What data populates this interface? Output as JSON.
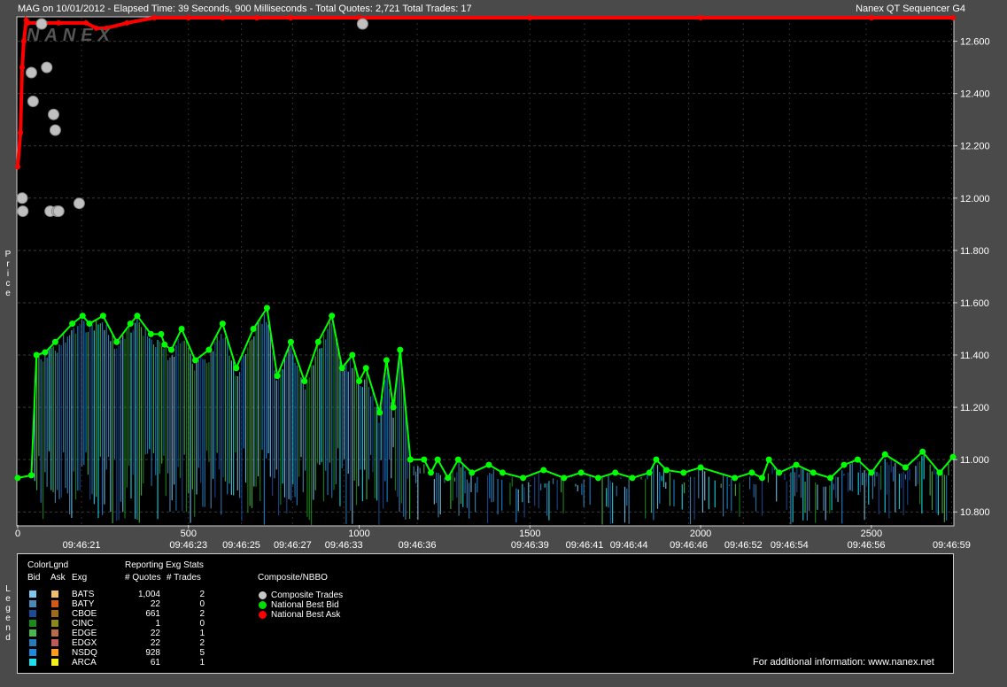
{
  "header": {
    "left": "MAG on 10/01/2012  -  Elapsed Time: 39 Seconds, 900 Milliseconds  -  Total Quotes: 2,721  Total Trades: 17",
    "right": "Nanex QT Sequencer G4",
    "watermark": "NANEX"
  },
  "side_labels": {
    "price": "Price",
    "legend": "Legend"
  },
  "chart_data": {
    "type": "line",
    "ylabel": "Price",
    "ylim": [
      10.75,
      12.69
    ],
    "xlim": [
      0,
      2739
    ],
    "y_ticks": [
      "12.600",
      "12.400",
      "12.200",
      "12.000",
      "11.800",
      "11.600",
      "11.400",
      "11.200",
      "11.000",
      "10.800"
    ],
    "y_tick_values": [
      12.6,
      12.4,
      12.2,
      12.0,
      11.8,
      11.6,
      11.4,
      11.2,
      11.0,
      10.8
    ],
    "x_ticks_top": [
      "0",
      "500",
      "1000",
      "1500",
      "2000",
      "2500"
    ],
    "x_tick_top_values": [
      0,
      500,
      1000,
      1500,
      2000,
      2500
    ],
    "x_ticks_time": [
      "09:46:21",
      "09:46:23",
      "09:46:25",
      "09:46:27",
      "09:46:33",
      "09:46:36",
      "09:46:39",
      "09:46:41",
      "09:46:44",
      "09:46:46",
      "09:46:52",
      "09:46:54",
      "09:46:56",
      "09:46:59"
    ],
    "x_tick_time_positions": [
      187,
      500,
      655,
      805,
      955,
      1170,
      1500,
      1660,
      1790,
      1965,
      2125,
      2260,
      2485,
      2735
    ],
    "series": [
      {
        "name": "National Best Ask",
        "color": "#ff0000",
        "x": [
          0,
          8,
          13,
          18,
          25,
          30,
          60,
          120,
          200,
          230,
          260,
          320,
          400,
          500,
          600,
          700,
          800,
          1000,
          1500,
          2000,
          2500,
          2739
        ],
        "y": [
          12.12,
          12.25,
          12.5,
          12.6,
          12.68,
          12.67,
          12.67,
          12.67,
          12.67,
          12.65,
          12.65,
          12.67,
          12.69,
          12.69,
          12.69,
          12.69,
          12.69,
          12.69,
          12.69,
          12.69,
          12.69,
          12.69
        ]
      },
      {
        "name": "National Best Bid",
        "color": "#00ff00",
        "x": [
          0,
          40,
          55,
          80,
          110,
          160,
          190,
          210,
          250,
          290,
          330,
          350,
          390,
          420,
          430,
          450,
          480,
          520,
          560,
          600,
          640,
          690,
          730,
          760,
          800,
          840,
          880,
          920,
          950,
          980,
          1000,
          1020,
          1060,
          1080,
          1100,
          1120,
          1150,
          1190,
          1210,
          1230,
          1260,
          1290,
          1330,
          1380,
          1420,
          1480,
          1540,
          1600,
          1650,
          1700,
          1750,
          1800,
          1850,
          1870,
          1900,
          1950,
          2000,
          2100,
          2150,
          2180,
          2200,
          2230,
          2280,
          2330,
          2380,
          2420,
          2460,
          2500,
          2540,
          2600,
          2650,
          2700,
          2739
        ],
        "y": [
          10.93,
          10.94,
          11.4,
          11.41,
          11.45,
          11.52,
          11.55,
          11.52,
          11.55,
          11.45,
          11.52,
          11.55,
          11.48,
          11.48,
          11.44,
          11.42,
          11.5,
          11.38,
          11.42,
          11.52,
          11.35,
          11.5,
          11.58,
          11.32,
          11.45,
          11.3,
          11.45,
          11.55,
          11.35,
          11.4,
          11.3,
          11.35,
          11.18,
          11.38,
          11.2,
          11.42,
          11.0,
          11.0,
          10.95,
          11.0,
          10.93,
          11.0,
          10.95,
          10.98,
          10.95,
          10.93,
          10.96,
          10.93,
          10.95,
          10.93,
          10.95,
          10.93,
          10.95,
          11.0,
          10.96,
          10.95,
          10.97,
          10.93,
          10.95,
          10.93,
          11.0,
          10.95,
          10.98,
          10.95,
          10.93,
          10.98,
          11.0,
          10.95,
          11.02,
          10.97,
          11.03,
          10.95,
          11.01
        ]
      },
      {
        "name": "Composite Trades",
        "color": "#c0c0c0",
        "x": [
          13,
          15,
          40,
          45,
          70,
          85,
          95,
          105,
          110,
          115,
          120,
          180,
          1010
        ],
        "y": [
          12.0,
          11.95,
          12.48,
          12.37,
          12.71,
          12.5,
          11.95,
          12.32,
          12.26,
          11.95,
          11.95,
          11.98,
          12.69
        ]
      }
    ]
  },
  "legend": {
    "color_legend_title": "ColorLgnd",
    "stats_title": "Reporting Exg Stats",
    "composite_title": "Composite/NBBO",
    "headers": {
      "bid": "Bid",
      "ask": "Ask",
      "exg": "Exg",
      "quotes": "# Quotes",
      "trades": "# Trades"
    },
    "rows": [
      {
        "exg": "BATS",
        "quotes": "1,004",
        "trades": "2",
        "bid_color": "#7ec8f0",
        "ask_color": "#f0c070"
      },
      {
        "exg": "BATY",
        "quotes": "22",
        "trades": "0",
        "bid_color": "#4a8ab8",
        "ask_color": "#d05a1a"
      },
      {
        "exg": "CBOE",
        "quotes": "661",
        "trades": "2",
        "bid_color": "#1a4a9a",
        "ask_color": "#a06a1a"
      },
      {
        "exg": "CINC",
        "quotes": "1",
        "trades": "0",
        "bid_color": "#1a8a1a",
        "ask_color": "#8a8a1a"
      },
      {
        "exg": "EDGE",
        "quotes": "22",
        "trades": "1",
        "bid_color": "#4ab84a",
        "ask_color": "#b86a4a"
      },
      {
        "exg": "EDGX",
        "quotes": "22",
        "trades": "2",
        "bid_color": "#2a7aba",
        "ask_color": "#ba5a5a"
      },
      {
        "exg": "NSDQ",
        "quotes": "928",
        "trades": "5",
        "bid_color": "#1a8ae0",
        "ask_color": "#ff9a1a"
      },
      {
        "exg": "ARCA",
        "quotes": "61",
        "trades": "1",
        "bid_color": "#1ae0f0",
        "ask_color": "#f0f01a"
      }
    ],
    "composite": [
      {
        "label": "Composite Trades",
        "color": "#c8c8c8"
      },
      {
        "label": "National Best Bid",
        "color": "#00e000"
      },
      {
        "label": "National Best Ask",
        "color": "#ff0000"
      }
    ],
    "footer": "For additional information: www.nanex.net"
  }
}
